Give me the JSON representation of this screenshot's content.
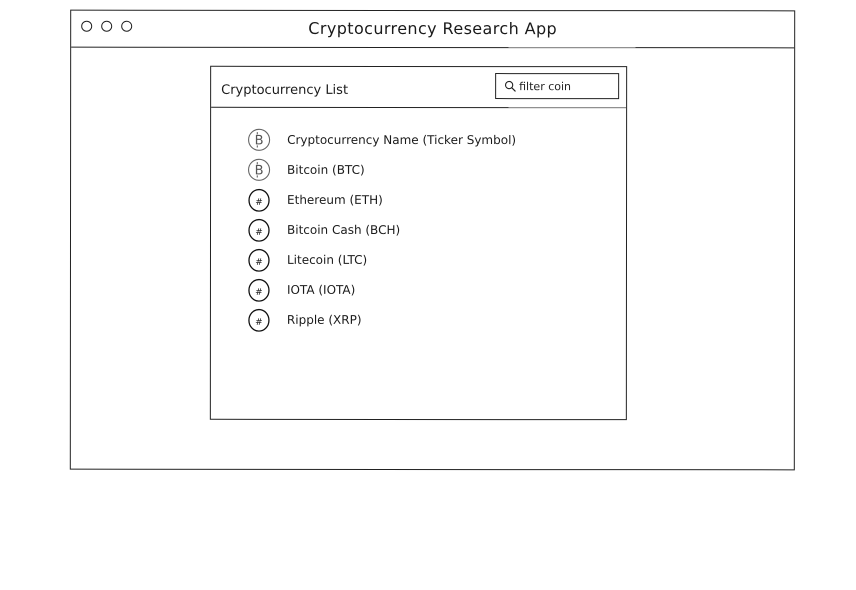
{
  "window": {
    "title": "Cryptocurrency Research App"
  },
  "panel": {
    "title": "Cryptocurrency List",
    "search": {
      "placeholder": "filter coin",
      "value": ""
    }
  },
  "coins": [
    {
      "label": "Cryptocurrency Name (Ticker Symbol)",
      "icon": "bitcoin-icon"
    },
    {
      "label": "Bitcoin (BTC)",
      "icon": "bitcoin-icon"
    },
    {
      "label": "Ethereum (ETH)",
      "icon": "coin-hash-icon"
    },
    {
      "label": "Bitcoin Cash (BCH)",
      "icon": "coin-hash-icon"
    },
    {
      "label": "Litecoin (LTC)",
      "icon": "coin-hash-icon"
    },
    {
      "label": "IOTA (IOTA)",
      "icon": "coin-hash-icon"
    },
    {
      "label": "Ripple (XRP)",
      "icon": "coin-hash-icon"
    }
  ]
}
